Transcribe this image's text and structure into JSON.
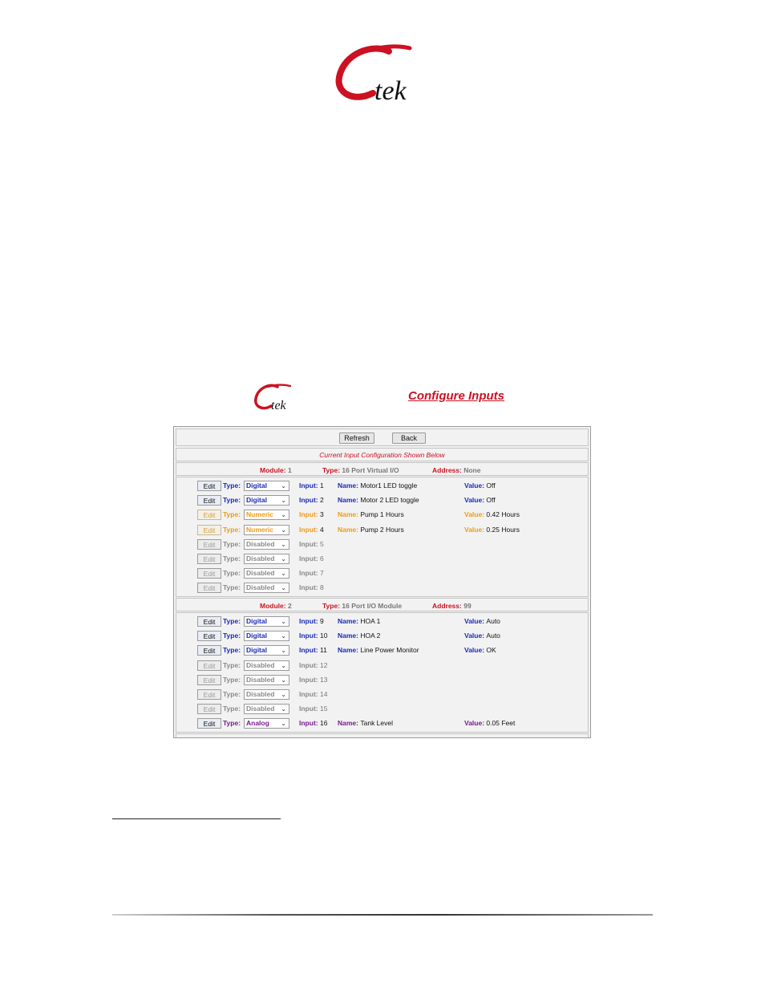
{
  "brand": {
    "logo_text": "Ctek"
  },
  "page": {
    "title": "Configure Inputs"
  },
  "toolbar": {
    "refresh_label": "Refresh",
    "back_label": "Back"
  },
  "banner": "Current Input Configuration Shown Below",
  "labels": {
    "module": "Module:",
    "type": "Type:",
    "address": "Address:",
    "input": "Input:",
    "name": "Name:",
    "value": "Value:",
    "edit": "Edit"
  },
  "modules": [
    {
      "module": "1",
      "type": "16 Port Virtual I/O",
      "address": "None",
      "inputs": [
        {
          "type": "Digital",
          "input": "1",
          "name": "Motor1 LED toggle",
          "value": "Off"
        },
        {
          "type": "Digital",
          "input": "2",
          "name": "Motor 2 LED toggle",
          "value": "Off"
        },
        {
          "type": "Numeric",
          "input": "3",
          "name": "Pump 1 Hours",
          "value": "0.42 Hours"
        },
        {
          "type": "Numeric",
          "input": "4",
          "name": "Pump 2 Hours",
          "value": "0.25 Hours"
        },
        {
          "type": "Disabled",
          "input": "5"
        },
        {
          "type": "Disabled",
          "input": "6"
        },
        {
          "type": "Disabled",
          "input": "7"
        },
        {
          "type": "Disabled",
          "input": "8"
        }
      ]
    },
    {
      "module": "2",
      "type": "16 Port I/O Module",
      "address": "99",
      "inputs": [
        {
          "type": "Digital",
          "input": "9",
          "name": "HOA 1",
          "value": "Auto"
        },
        {
          "type": "Digital",
          "input": "10",
          "name": "HOA 2",
          "value": "Auto"
        },
        {
          "type": "Digital",
          "input": "11",
          "name": "Line Power Monitor",
          "value": "OK"
        },
        {
          "type": "Disabled",
          "input": "12"
        },
        {
          "type": "Disabled",
          "input": "13"
        },
        {
          "type": "Disabled",
          "input": "14"
        },
        {
          "type": "Disabled",
          "input": "15"
        },
        {
          "type": "Analog",
          "input": "16",
          "name": "Tank Level",
          "value": "0.05 Feet"
        }
      ]
    }
  ],
  "colors": {
    "brand_red": "#cc1122",
    "digital": "#1a2ab8",
    "numeric": "#ef9b12",
    "disabled": "#8a8a8a",
    "analog": "#7a1a8f"
  }
}
